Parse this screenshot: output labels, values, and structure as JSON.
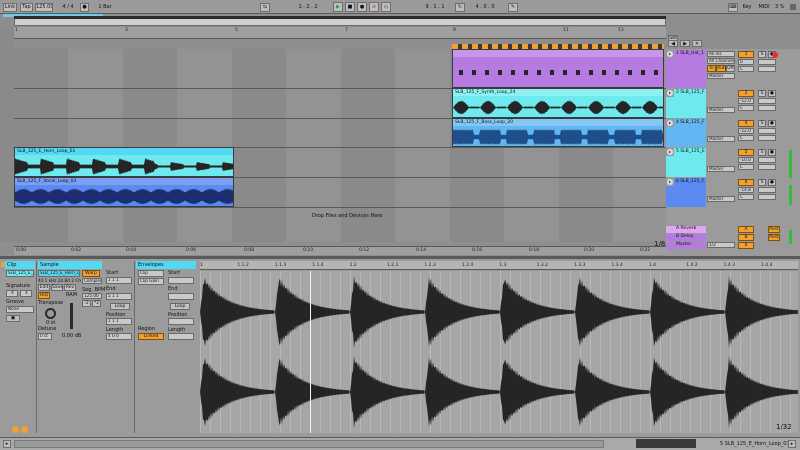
{
  "transport": {
    "link_label": "Link",
    "tap_label": "Tap",
    "tempo": "125.00",
    "time_signature": "4 / 4",
    "quantize": "1 Bar",
    "arrangement_position": "1 . 2 . 2",
    "loop_start": "9 . 1 . 1",
    "loop_length": "4 . 0 . 0",
    "key_label": "Key",
    "midi_label": "MIDI",
    "cpu": "3 %"
  },
  "ruler": {
    "bars": [
      "1",
      "3",
      "5",
      "7",
      "9",
      "11",
      "13"
    ],
    "times": [
      "0:00",
      "0:02",
      "0:04",
      "0:06",
      "0:08",
      "0:10",
      "0:12",
      "0:14",
      "0:16",
      "0:18",
      "0:20",
      "0:22"
    ],
    "set_label": "Set"
  },
  "tracks": [
    {
      "name": "1 SLB_Hat_1",
      "color": "#b57be0",
      "in": "All Ins",
      "ch": "All Channels",
      "monitor": "In",
      "auto": "Auto",
      "off": "Off",
      "out": "Master",
      "num": "1",
      "vol": "0",
      "pan": "C",
      "clips": [
        {
          "name": "",
          "kind": "hat"
        }
      ]
    },
    {
      "name": "2 SLB_125_F",
      "color": "#6ee9ee",
      "out": "Master",
      "num": "2",
      "vol": "-12.0",
      "pan": "C",
      "clips": [
        {
          "name": "SLB_125_F_Synth_Loop_24",
          "kind": "synth"
        }
      ]
    },
    {
      "name": "4 SLB_125_F",
      "color": "#62b6f2",
      "out": "Master",
      "num": "4",
      "vol": "-12.0",
      "pan": "C",
      "clips": [
        {
          "name": "SLB_125_F_Bass_Loop_20",
          "kind": "bass"
        }
      ]
    },
    {
      "name": "5 SLB_125_E",
      "color": "#6ee9ee",
      "out": "Master",
      "num": "5",
      "vol": "-10.0",
      "pan": "C",
      "clips": [
        {
          "name": "SLB_125_E_Horn_Loop_01",
          "kind": "horn"
        }
      ]
    },
    {
      "name": "6 SLB_125_F",
      "color": "#5b8af0",
      "out": "Master",
      "num": "6",
      "vol": "-14.8",
      "pan": "C",
      "clips": [
        {
          "name": "SLB_125_F_Vocal_Loop_03",
          "kind": "vocal"
        }
      ]
    }
  ],
  "drop_zone": "Drop Files and Devices Here",
  "returns": [
    {
      "name": "A Reverb",
      "color": "#dfa6f2",
      "num": "A",
      "post": "Post"
    },
    {
      "name": "B Delay",
      "color": "#b57be0",
      "num": "B",
      "post": "Post"
    },
    {
      "name": "Master",
      "color": "#b57be0",
      "num": "0",
      "out": "1/2"
    }
  ],
  "zoom_fraction": "1/8",
  "clip_view": {
    "clip_section": "Clip",
    "clip_name": "SLB_125_E_Horn_L",
    "signature_label": "Signature",
    "sig_num": "4",
    "sig_den": "4",
    "groove_label": "Groove",
    "groove_value": "None",
    "sample_section": "Sample",
    "sample_name": "SLB_125_E_Horn_L",
    "sample_info": "44.1 kHz 24 Bit 2 Ch",
    "edit_label": "Edit",
    "save_label": "Save",
    "rev_label": "Rev",
    "hiq_label": "HiQ",
    "ram_label": "RAM",
    "warp_label": "Warp",
    "warp_mode": "Complex",
    "seg_bpm_label": "Seg. BPM",
    "seg_bpm": "125.00",
    "half_label": ":2",
    "double_label": "*2",
    "transpose_label": "Transpose",
    "transpose_value": "0 st",
    "detune_label": "Detune",
    "detune_value": "0 ct",
    "gain_value": "0.00 dB",
    "start_label": "Start",
    "start_value": "1 1 1",
    "end_label": "End",
    "end_value": "5 1 1",
    "loop_label": "Loop",
    "position_label": "Position",
    "position_value": "1 1 1",
    "length_label": "Length",
    "length_value": "4 0 0",
    "envelopes_section": "Envelopes",
    "env_source": "Clip",
    "env_target": "Clip Gain",
    "env_start_label": "Start",
    "env_end_label": "End",
    "region_label": "Region",
    "region_value": "Linked",
    "env_loop_label": "Loop",
    "env_position_label": "Position",
    "env_length_label": "Length"
  },
  "sample_editor": {
    "ticks": [
      "1",
      "1.1.2",
      "1.1.3",
      "1.1.4",
      "1.2",
      "1.2.2",
      "1.2.3",
      "1.2.4",
      "1.3",
      "1.3.2",
      "1.3.3",
      "1.3.4",
      "1.4",
      "1.4.2",
      "1.4.3",
      "1.4.4"
    ],
    "zoom": "1/32"
  },
  "status": {
    "selected_clip": "5 SLB_125_E_Horn_Loop_01"
  },
  "colors": {
    "accent_orange": "#f2a12e",
    "hat_purple": "#b57be0",
    "synth_cyan": "#6ee9ee",
    "bass_blue": "#62b6f2",
    "vocal_blue": "#5b8af0",
    "selection_cyan": "#54d8f4",
    "waveform": "#252525"
  }
}
